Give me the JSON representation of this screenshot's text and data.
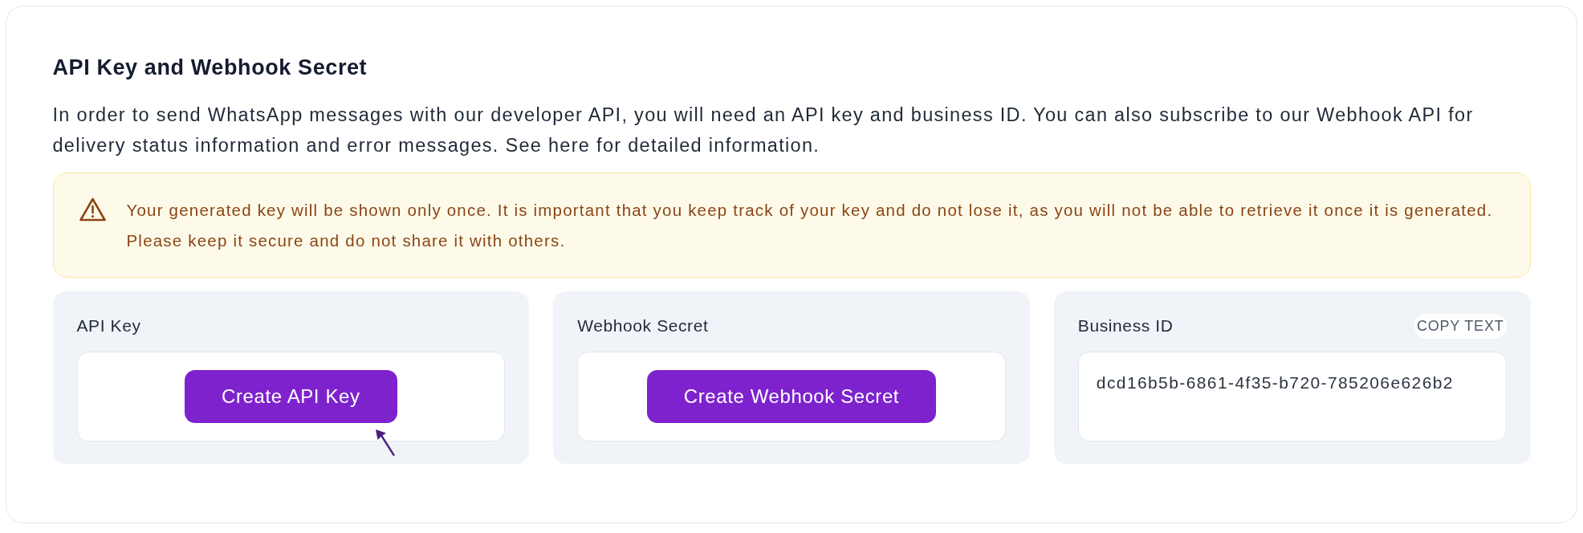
{
  "section": {
    "title": "API Key and Webhook Secret",
    "description": "In order to send WhatsApp messages with our developer API, you will need an API key and business ID. You can also subscribe to our Webhook API for delivery status information and error messages. See here for detailed information."
  },
  "notice": {
    "kind": "warning",
    "text": "Your generated key will be shown only once. It is important that you keep track of your key and do not lose it, as you will not be able to retrieve it once it is generated. Please keep it secure and do not share it with others."
  },
  "cards": [
    {
      "kind": "action",
      "label": "API Key",
      "button": "Create API Key",
      "hovered": true
    },
    {
      "kind": "action",
      "label": "Webhook Secret",
      "button": "Create Webhook Secret",
      "hovered": false
    },
    {
      "kind": "value",
      "label": "Business ID",
      "copy_button": "COPY TEXT",
      "value": "dcd16b5b-6861-4f35-b720-785206e626b2"
    }
  ]
}
